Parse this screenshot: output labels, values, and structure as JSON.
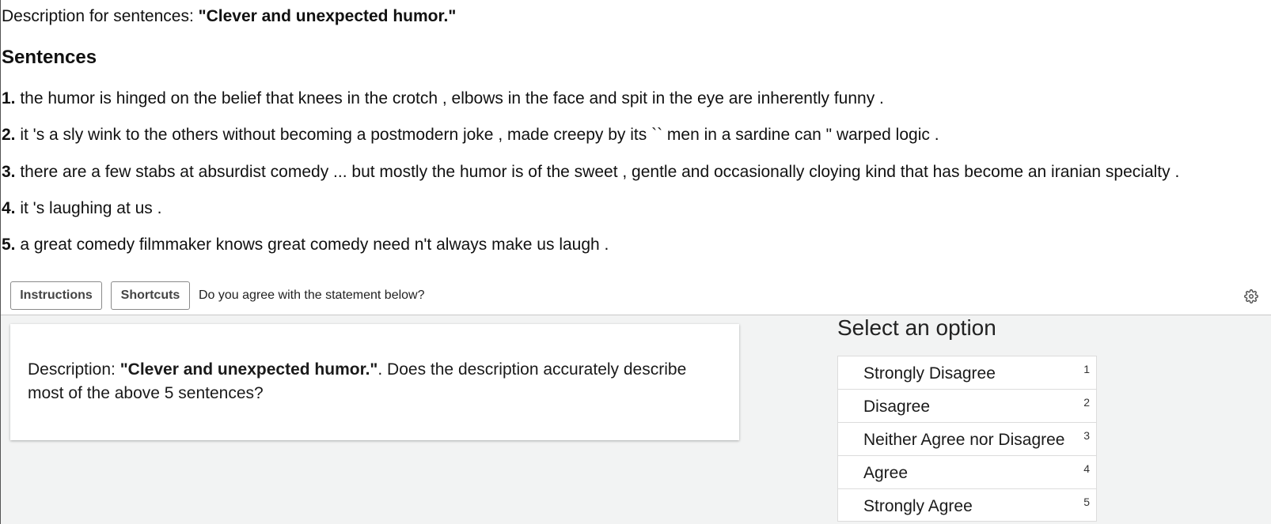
{
  "header": {
    "description_prefix": "Description for sentences: ",
    "description_quote": "\"Clever and unexpected humor.\""
  },
  "sentences_heading": "Sentences",
  "sentences": [
    {
      "num": "1.",
      "text": " the humor is hinged on the belief that knees in the crotch , elbows in the face and spit in the eye are inherently funny ."
    },
    {
      "num": "2.",
      "text": " it 's a sly wink to the others without becoming a postmodern joke , made creepy by its `` men in a sardine can \" warped logic ."
    },
    {
      "num": "3.",
      "text": " there are a few stabs at absurdist comedy ... but mostly the humor is of the sweet , gentle and occasionally cloying kind that has become an iranian specialty ."
    },
    {
      "num": "4.",
      "text": " it 's laughing at us ."
    },
    {
      "num": "5.",
      "text": " a great comedy filmmaker knows great comedy need n't always make us laugh ."
    }
  ],
  "toolbar": {
    "instructions_label": "Instructions",
    "shortcuts_label": "Shortcuts",
    "prompt": "Do you agree with the statement below?",
    "settings_icon": "gear-icon"
  },
  "card": {
    "prefix": "Description: ",
    "quote": "\"Clever and unexpected humor.\"",
    "suffix": ". Does the description accurately describe most of the above 5 sentences?"
  },
  "options_panel": {
    "title": "Select an option",
    "options": [
      {
        "label": "Strongly Disagree",
        "key": "1"
      },
      {
        "label": "Disagree",
        "key": "2"
      },
      {
        "label": "Neither Agree nor Disagree",
        "key": "3"
      },
      {
        "label": "Agree",
        "key": "4"
      },
      {
        "label": "Strongly Agree",
        "key": "5"
      }
    ]
  }
}
